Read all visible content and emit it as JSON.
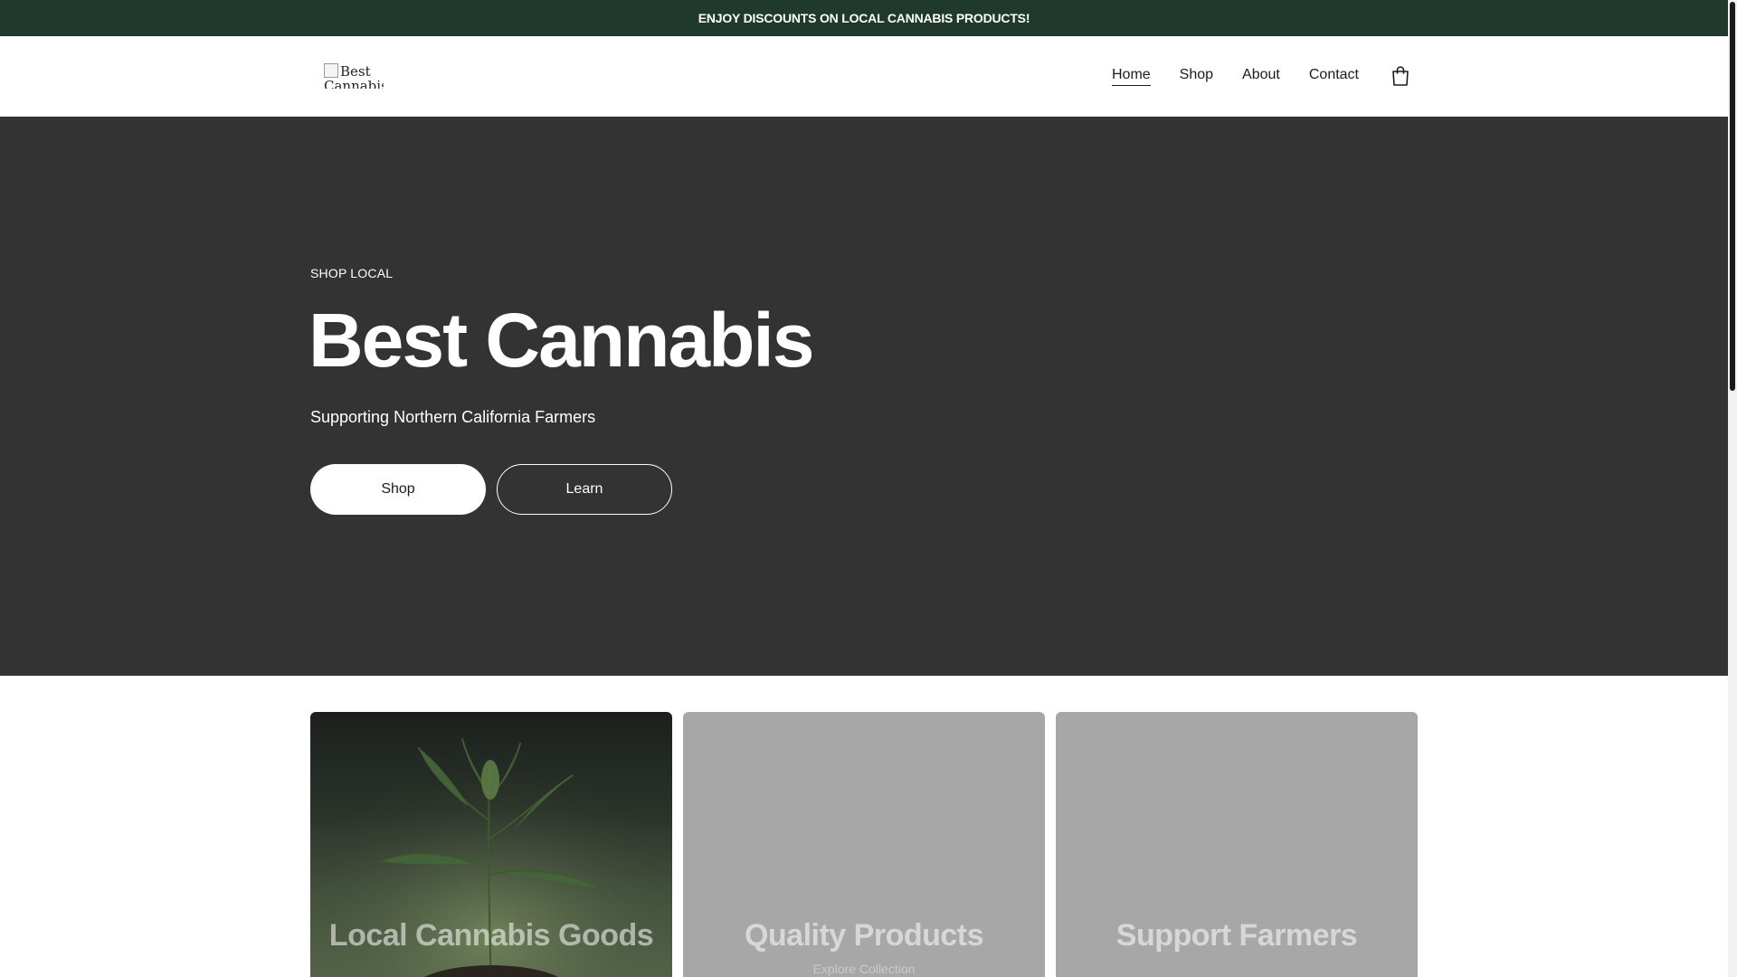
{
  "announcement": {
    "text": "ENJOY DISCOUNTS ON LOCAL CANNABIS PRODUCTS!"
  },
  "header": {
    "logo_alt": "Best Cannabis",
    "nav": [
      {
        "label": "Home",
        "active": true
      },
      {
        "label": "Shop",
        "active": false
      },
      {
        "label": "About",
        "active": false
      },
      {
        "label": "Contact",
        "active": false
      }
    ],
    "cart_icon": "shopping-bag-icon"
  },
  "hero": {
    "eyebrow": "SHOP LOCAL",
    "title": "Best Cannabis",
    "subtitle": "Supporting Northern California Farmers",
    "buttons": {
      "primary": "Shop",
      "secondary": "Learn"
    }
  },
  "cards": [
    {
      "title": "Local Cannabis Goods",
      "subtitle": ""
    },
    {
      "title": "Quality Products",
      "subtitle": "Explore Collection"
    },
    {
      "title": "Support Farmers",
      "subtitle": ""
    }
  ],
  "colors": {
    "announcement_bg": "#1f3a2d",
    "hero_bg": "#333333",
    "card_placeholder_bg": "#a7a7a7",
    "text_dark": "#1b1b1b"
  }
}
